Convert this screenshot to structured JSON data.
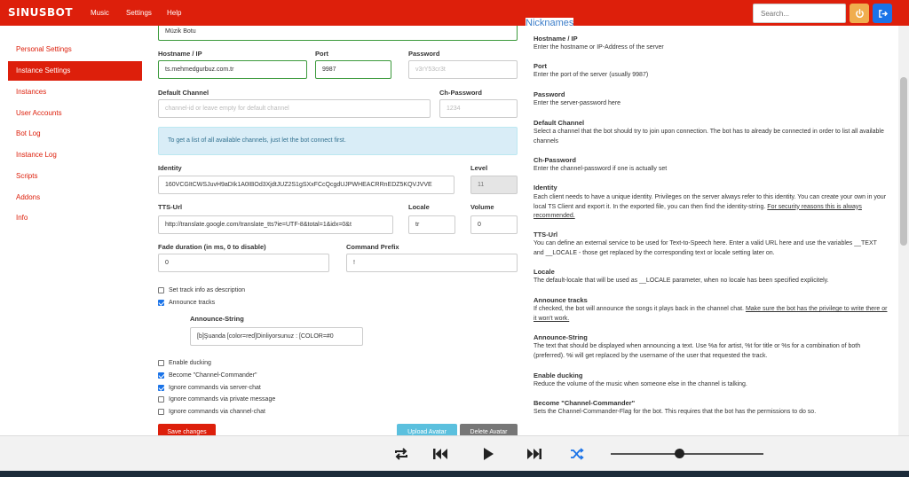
{
  "app": {
    "brand": "SINUSBOT",
    "nav": [
      "Music",
      "Settings",
      "Help"
    ],
    "search_placeholder": "Search..."
  },
  "sidebar": {
    "items": [
      {
        "label": "Personal Settings",
        "active": false
      },
      {
        "label": "Instance Settings",
        "active": true
      },
      {
        "label": "Instances",
        "active": false
      },
      {
        "label": "User Accounts",
        "active": false
      },
      {
        "label": "Bot Log",
        "active": false
      },
      {
        "label": "Instance Log",
        "active": false
      },
      {
        "label": "Scripts",
        "active": false
      },
      {
        "label": "Addons",
        "active": false
      },
      {
        "label": "Info",
        "active": false
      }
    ]
  },
  "form": {
    "nickname_value": "Müzik Botu",
    "hostname_label": "Hostname / IP",
    "hostname_value": "ts.mehmedgurbuz.com.tr",
    "port_label": "Port",
    "port_value": "9987",
    "password_label": "Password",
    "password_value": "v3rY53cr3t",
    "channel_label": "Default Channel",
    "channel_placeholder": "channel-id or leave empty for default channel",
    "chpass_label": "Ch-Password",
    "chpass_placeholder": "1234",
    "alert_text": "To get a list of all available channels, just let the bot connect first.",
    "identity_label": "Identity",
    "identity_value": "160VCGItCWSJuvH9aDIk1A0IBOd3XjdtJUZ2S1gSXxFCcQcgdUJPWHEACRRnEDZ5KQVJVVE",
    "level_label": "Level",
    "level_value": "11",
    "tts_label": "TTS-Url",
    "tts_value": "http://translate.google.com/translate_tts?ie=UTF-8&total=1&idx=0&t",
    "locale_label": "Locale",
    "locale_value": "tr",
    "volume_label": "Volume",
    "volume_value": "0",
    "fade_label": "Fade duration (in ms, 0 to disable)",
    "fade_value": "0",
    "prefix_label": "Command Prefix",
    "prefix_value": "!",
    "checkboxes_a": [
      {
        "label": "Set track info as description",
        "checked": false
      },
      {
        "label": "Announce tracks",
        "checked": true
      }
    ],
    "announce_label": "Announce-String",
    "announce_value": "[b]Şuanda [color=red]Dinliyorsunuz : [COLOR=#0",
    "checkboxes_b": [
      {
        "label": "Enable ducking",
        "checked": false
      },
      {
        "label": "Become \"Channel-Commander\"",
        "checked": true
      },
      {
        "label": "Ignore commands via server-chat",
        "checked": true
      },
      {
        "label": "Ignore commands via private message",
        "checked": false
      },
      {
        "label": "Ignore commands via channel-chat",
        "checked": false
      }
    ],
    "save_label": "Save changes",
    "upload_label": "Upload Avatar",
    "delete_label": "Delete Avatar"
  },
  "help": {
    "nicknames_title": "Nicknames",
    "sections": [
      {
        "title": "Hostname / IP",
        "desc": "Enter the hostname or IP-Address of the server"
      },
      {
        "title": "Port",
        "desc": "Enter the port of the server (usually 9987)"
      },
      {
        "title": "Password",
        "desc": "Enter the server-password here"
      },
      {
        "title": "Default Channel",
        "desc": "Select a channel that the bot should try to join upon connection. The bot has to already be connected in order to list all available channels"
      },
      {
        "title": "Ch-Password",
        "desc": "Enter the channel-password if one is actually set"
      },
      {
        "title": "Identity",
        "desc": "Each client needs to have a unique identity. Privileges on the server always refer to this identity. You can create your own in your local TS Client and export it. In the exported file, you can then find the identity-string. ",
        "link": "For security reasons this is always recommended."
      },
      {
        "title": "TTS-Url",
        "desc": "You can define an external service to be used for Text-to-Speech here. Enter a valid URL here and use the variables __TEXT and __LOCALE - those get replaced by the corresponding text or locale setting later on."
      },
      {
        "title": "Locale",
        "desc": "The default-locale that will be used as __LOCALE parameter, when no locale has been specified explicitely."
      },
      {
        "title": "Announce tracks",
        "desc": "If checked, the bot will announce the songs it plays back in the channel chat. ",
        "link": "Make sure the bot has the privilege to write there or it won't work."
      },
      {
        "title": "Announce-String",
        "desc": "The text that should be displayed when announcing a text. Use %a for artist, %t for title or %s for a combination of both (preferred). %i will get replaced by the username of the user that requested the track."
      },
      {
        "title": "Enable ducking",
        "desc": "Reduce the volume of the music when someone else in the channel is talking."
      },
      {
        "title": "Become \"Channel-Commander\"",
        "desc": "Sets the Channel-Commander-Flag for the bot. This requires that the bot has the permissions to do so."
      }
    ]
  },
  "player": {
    "volume_fraction": 0.45
  },
  "colors": {
    "brand": "#dd1f0b",
    "accent_blue": "#1a73e8",
    "help_link": "#3d7ec9"
  }
}
